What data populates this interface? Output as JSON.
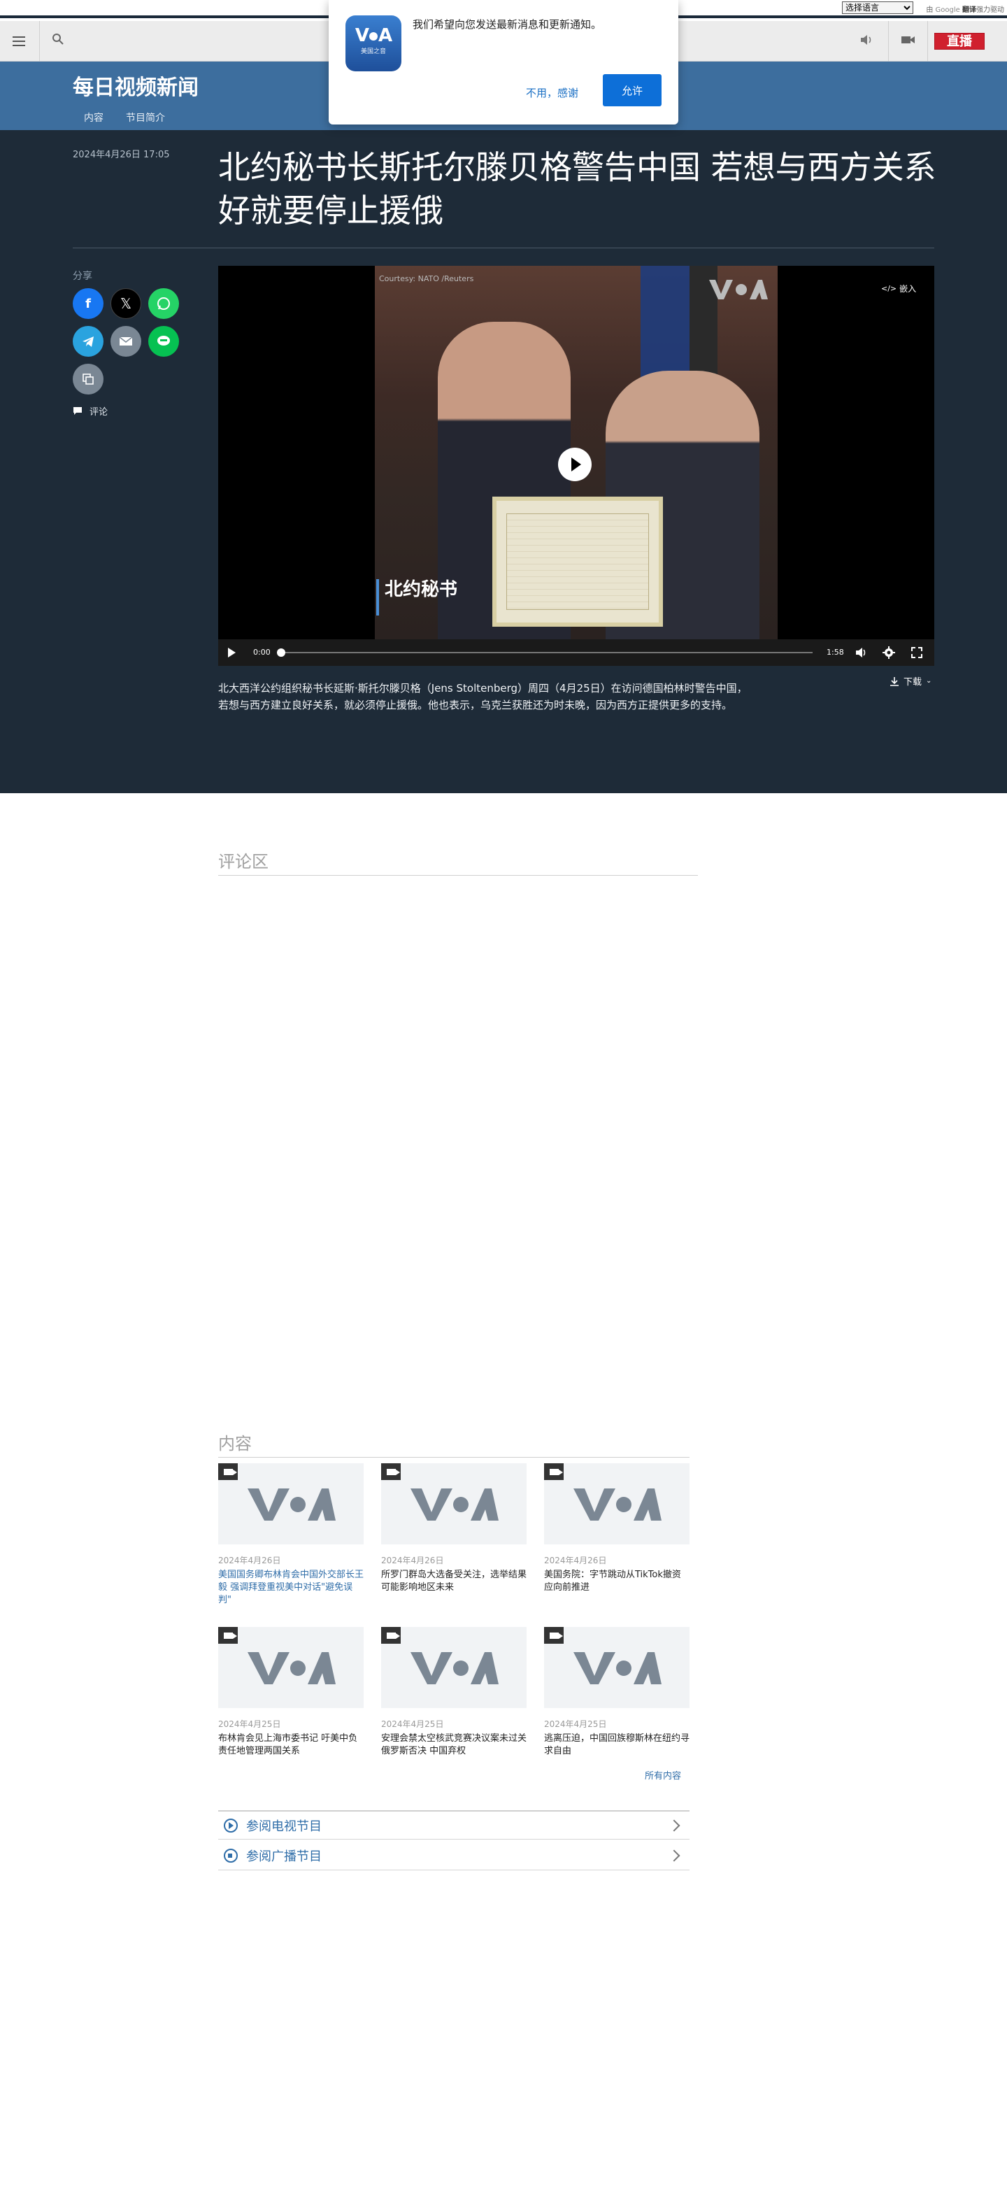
{
  "lang_bar": {
    "select_value": "选择语言",
    "google_prefix": "由",
    "google_word": "Google",
    "translate_word": "翻译",
    "powered": "强力驱动"
  },
  "toolbar": {
    "live_label": "直播"
  },
  "banner": {
    "program_title": "每日视频新闻",
    "nav": [
      "内容",
      "节目简介"
    ]
  },
  "article": {
    "date": "2024年4月26日 17:05",
    "headline": "北约秘书长斯托尔滕贝格警告中国 若想与西方关系好就要停止援俄",
    "share_label": "分享",
    "comment_link": "评论",
    "caption": "北大西洋公约组织秘书长延斯·斯托尔滕贝格（Jens Stoltenberg）周四（4月25日）在访问德国柏林时警告中国，若想与西方建立良好关系，就必须停止援俄。他也表示，乌克兰获胜还为时未晚，因为西方正提供更多的支持。",
    "download_label": "下载"
  },
  "player": {
    "courtesy": "Courtesy: NATO /Reuters",
    "embed_label": "嵌入",
    "subtitle_text": "北约秘书",
    "time_current": "0:00",
    "time_total": "1:58",
    "progress": 0
  },
  "notification": {
    "logo_small": "美国之音",
    "message": "我们希望向您发送最新消息和更新通知。",
    "decline": "不用，感谢",
    "accept": "允许"
  },
  "comments": {
    "heading": "评论区"
  },
  "content": {
    "heading": "内容",
    "items": [
      {
        "date": "2024年4月26日",
        "title": "美国国务卿布林肯会中国外交部长王毅 强调拜登重视美中对话\"避免误判\""
      },
      {
        "date": "2024年4月26日",
        "title": "所罗门群岛大选备受关注，选举结果可能影响地区未来"
      },
      {
        "date": "2024年4月26日",
        "title": "美国务院：字节跳动从TikTok撤资应向前推进"
      },
      {
        "date": "2024年4月25日",
        "title": "布林肯会见上海市委书记 吁美中负责任地管理两国关系"
      },
      {
        "date": "2024年4月25日",
        "title": "安理会禁太空核武竞赛决议案未过关 俄罗斯否决 中国弃权"
      },
      {
        "date": "2024年4月25日",
        "title": "逃离压迫，中国回族穆斯林在纽约寻求自由"
      }
    ],
    "all_label": "所有内容"
  },
  "program_links": {
    "tv": "参阅电视节目",
    "radio": "参阅广播节目"
  },
  "colors": {
    "banner_blue": "#3d6e9e",
    "dark_bg": "#1e2b38",
    "live_red": "#d0202e",
    "link_blue": "#2f6da8"
  }
}
